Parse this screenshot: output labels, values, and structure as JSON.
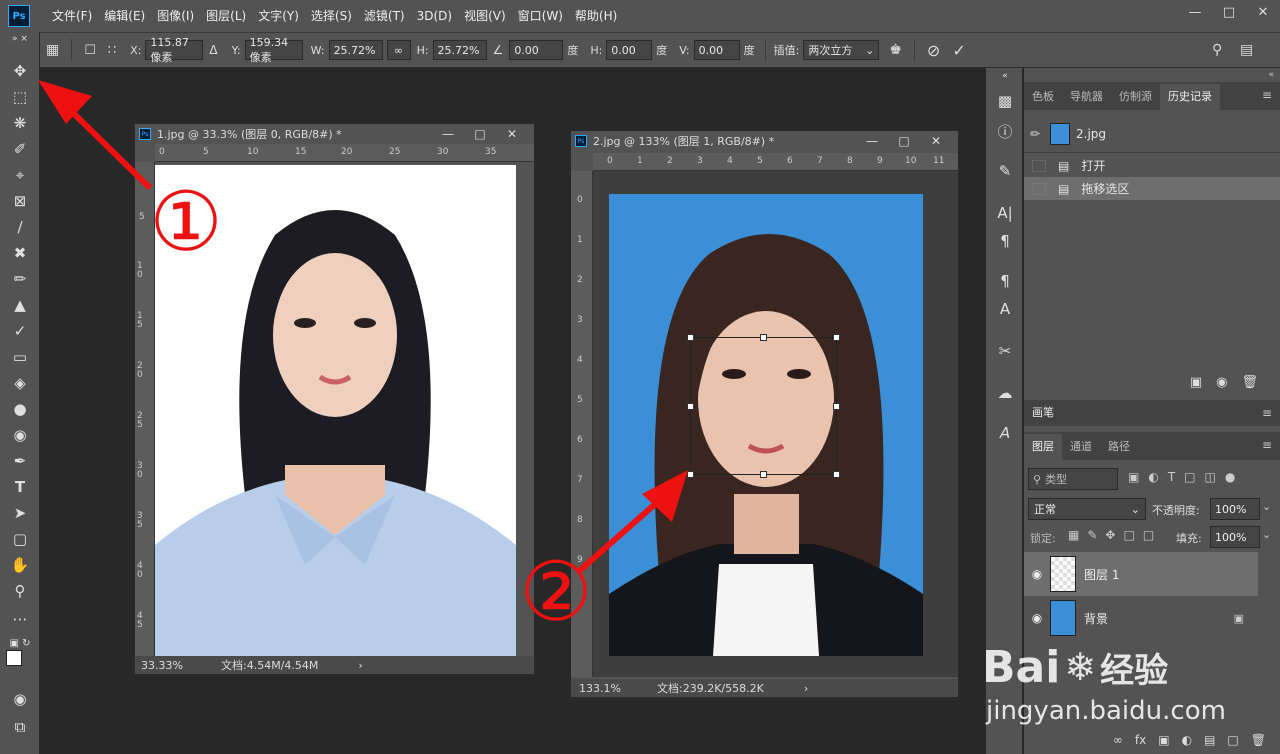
{
  "menu": {
    "logo": "Ps",
    "items": [
      "文件(F)",
      "编辑(E)",
      "图像(I)",
      "图层(L)",
      "文字(Y)",
      "选择(S)",
      "滤镜(T)",
      "3D(D)",
      "视图(V)",
      "窗口(W)",
      "帮助(H)"
    ]
  },
  "options": {
    "x_label": "X:",
    "x_value": "115.87 像素",
    "y_label": "Y:",
    "y_value": "159.34 像素",
    "w_label": "W:",
    "w_value": "25.72%",
    "h_label": "H:",
    "h_value": "25.72%",
    "angle_value": "0.00",
    "angle_unit": "度",
    "hskew_label": "H:",
    "hskew_value": "0.00",
    "hskew_unit": "度",
    "vskew_label": "V:",
    "vskew_value": "0.00",
    "vskew_unit": "度",
    "interp_label": "插值:",
    "interp_value": "两次立方"
  },
  "doc1": {
    "title": "1.jpg @ 33.3% (图层 0, RGB/8#) *",
    "zoom": "33.33%",
    "doc_info": "文档:4.54M/4.54M",
    "ruler_h": [
      "0",
      "5",
      "10",
      "15",
      "20",
      "25",
      "30",
      "35"
    ],
    "ruler_v": [
      "5",
      "1 0",
      "1 5",
      "2 0",
      "2 5",
      "3 0",
      "3 5",
      "4 0",
      "4 5"
    ]
  },
  "doc2": {
    "title": "2.jpg @ 133% (图层 1, RGB/8#) *",
    "zoom": "133.1%",
    "doc_info": "文档:239.2K/558.2K",
    "ruler_h": [
      "0",
      "1",
      "2",
      "3",
      "4",
      "5",
      "6",
      "7",
      "8",
      "9",
      "10",
      "11"
    ],
    "ruler_v": [
      "0",
      "1",
      "2",
      "3",
      "4",
      "5",
      "6",
      "7",
      "8",
      "9"
    ]
  },
  "annotations": {
    "one": "①",
    "two": "②"
  },
  "history": {
    "tabs": [
      "色板",
      "导航器",
      "仿制源",
      "历史记录"
    ],
    "snapshot": "2.jpg",
    "items": [
      "打开",
      "拖移选区"
    ]
  },
  "brush": {
    "tab": "画笔"
  },
  "layers": {
    "tabs": [
      "图层",
      "通道",
      "路径"
    ],
    "filter_label": "类型",
    "blend_mode": "正常",
    "opacity_label": "不透明度:",
    "opacity_value": "100%",
    "lock_label": "锁定:",
    "fill_label": "填充:",
    "fill_value": "100%",
    "items": [
      "图层 1",
      "背景"
    ]
  },
  "watermark": {
    "brand": "Bai",
    "brand2": "经验",
    "url": "jingyan.baidu.com"
  }
}
